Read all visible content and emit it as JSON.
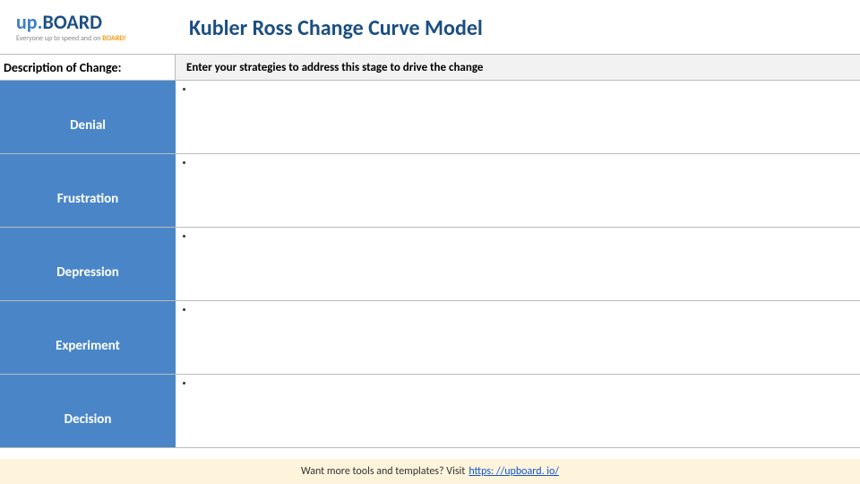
{
  "logo": {
    "prefix": "up.",
    "main": "BOARD",
    "tagline_pre": "Everyone up to speed and on ",
    "tagline_em": "BOARD!"
  },
  "title": "Kubler Ross Change Curve Model",
  "description": {
    "label": "Description of Change:",
    "placeholder": "Enter your strategies to address this stage to drive the change"
  },
  "stages": [
    {
      "name": "Denial"
    },
    {
      "name": "Frustration"
    },
    {
      "name": "Depression"
    },
    {
      "name": "Experiment"
    },
    {
      "name": "Decision"
    }
  ],
  "footer": {
    "text": "Want more tools and templates? Visit",
    "link": "https: //upboard. io/"
  }
}
